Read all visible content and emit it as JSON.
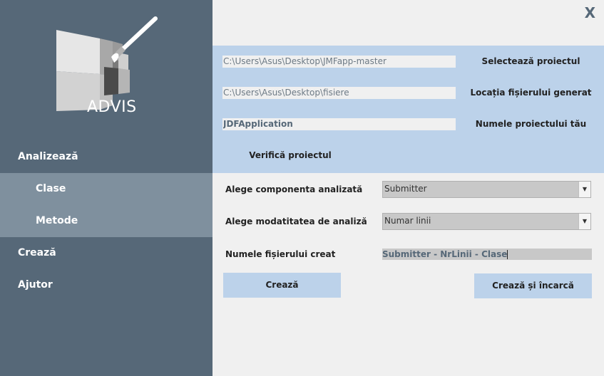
{
  "logo": {
    "text": "ADVIS",
    "icon": "paintbrush-grid-logo"
  },
  "nav": {
    "analyze": "Analizează",
    "classes": "Clase",
    "methods": "Metode",
    "create": "Crează",
    "help": "Ajutor"
  },
  "window": {
    "close_label": "X"
  },
  "project": {
    "project_path": "C:\\Users\\Asus\\Desktop\\JMFapp-master",
    "select_label": "Selectează proiectul",
    "output_path": "C:\\Users\\Asus\\Desktop\\fisiere",
    "output_label": "Locația fișierului generat",
    "project_name": "JDFApplication",
    "name_label": "Numele proiectului tău",
    "verify_label": "Verifică proiectul"
  },
  "form": {
    "component_label": "Alege componenta analizată",
    "component_value": "Submitter",
    "mode_label": "Alege modatitatea de analiză",
    "mode_value": "Numar linii",
    "filename_label": "Numele fișierului creat",
    "filename_value": "Submitter - NrLinii - Clase"
  },
  "actions": {
    "create": "Crează",
    "create_upload": "Crează și încarcă"
  },
  "colors": {
    "sidebar": "#566878",
    "sidebar_selected": "#7f909e",
    "accent_panel": "#bcd2ea",
    "background": "#f0f0f0"
  }
}
